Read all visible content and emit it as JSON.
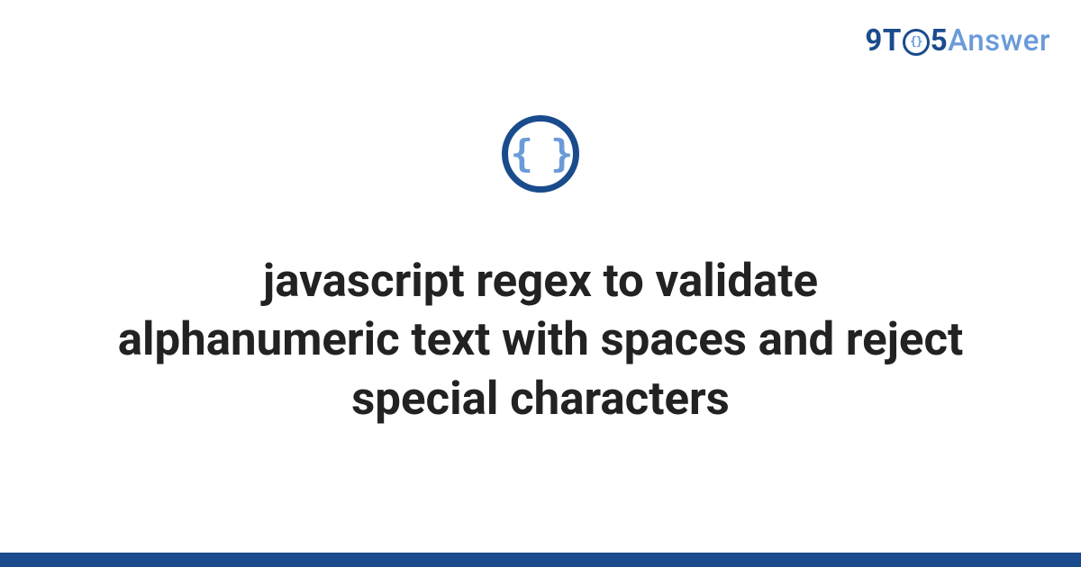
{
  "brand": {
    "nine": "9",
    "t": "T",
    "five": "5",
    "answer": "Answer",
    "icon_braces": "{}"
  },
  "icon": {
    "braces": "{ }"
  },
  "title": "javascript regex to validate alphanumeric text with spaces and reject special characters",
  "colors": {
    "primary": "#1a4b8c",
    "accent": "#6a9bd8"
  }
}
